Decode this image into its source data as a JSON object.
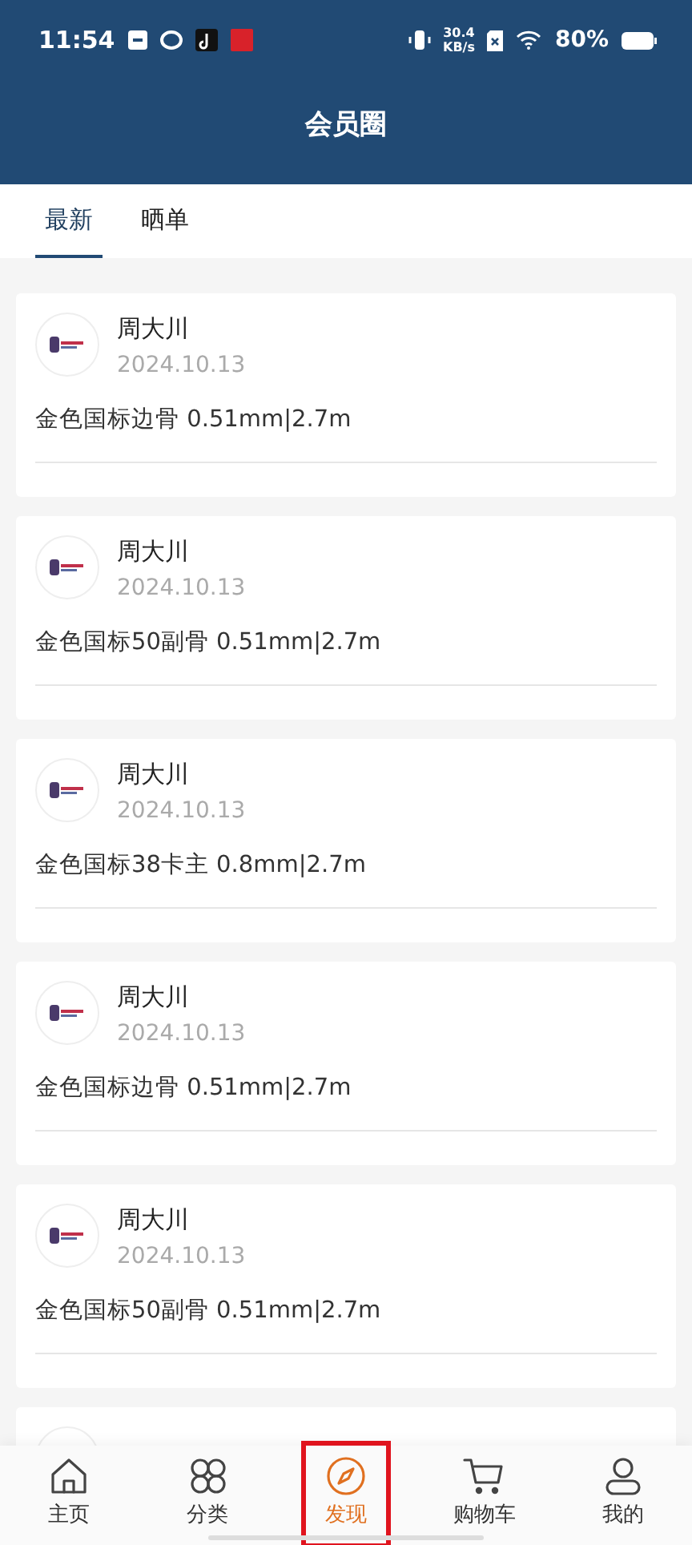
{
  "status_bar": {
    "time": "11:54",
    "speed": "30.4",
    "speed_unit": "KB/s",
    "battery": "80%"
  },
  "header": {
    "title": "会员圈"
  },
  "tabs": [
    {
      "label": "最新",
      "selected": true
    },
    {
      "label": "晒单",
      "selected": false
    }
  ],
  "posts": [
    {
      "author": "周大川",
      "date": "2024.10.13",
      "text": "金色国标边骨 0.51mm|2.7m"
    },
    {
      "author": "周大川",
      "date": "2024.10.13",
      "text": "金色国标50副骨 0.51mm|2.7m"
    },
    {
      "author": "周大川",
      "date": "2024.10.13",
      "text": "金色国标38卡主 0.8mm|2.7m"
    },
    {
      "author": "周大川",
      "date": "2024.10.13",
      "text": "金色国标边骨 0.51mm|2.7m"
    },
    {
      "author": "周大川",
      "date": "2024.10.13",
      "text": "金色国标50副骨 0.51mm|2.7m"
    },
    {
      "cut_off": true
    }
  ],
  "nav": [
    {
      "label": "主页",
      "kind": "home",
      "selected": false,
      "highlighted": false
    },
    {
      "label": "分类",
      "kind": "category",
      "selected": false,
      "highlighted": false
    },
    {
      "label": "发现",
      "kind": "discover",
      "selected": true,
      "highlighted": true
    },
    {
      "label": "购物车",
      "kind": "cart",
      "selected": false,
      "highlighted": false
    },
    {
      "label": "我的",
      "kind": "profile",
      "selected": false,
      "highlighted": false
    }
  ]
}
